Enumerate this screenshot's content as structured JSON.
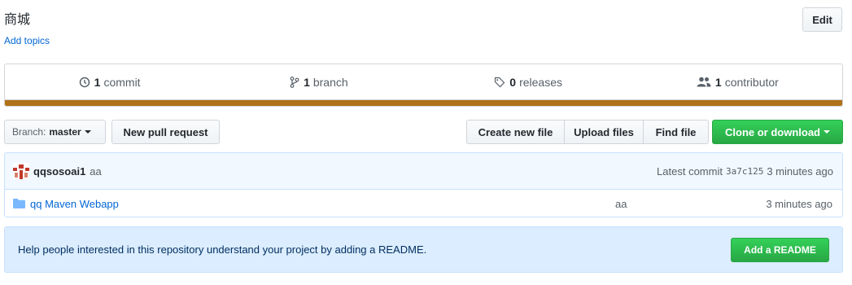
{
  "repo": {
    "description": "商城",
    "add_topics": "Add topics",
    "edit_label": "Edit"
  },
  "summary": {
    "commits": {
      "count": "1",
      "label": "commit",
      "icon": "history-icon"
    },
    "branches": {
      "count": "1",
      "label": "branch",
      "icon": "git-branch-icon"
    },
    "releases": {
      "count": "0",
      "label": "releases",
      "icon": "tag-icon"
    },
    "contributors": {
      "count": "1",
      "label": "contributor",
      "icon": "people-icon"
    },
    "language_color": "#b07219"
  },
  "toolbar": {
    "branch_label": "Branch:",
    "branch_value": "master",
    "new_pull_request": "New pull request",
    "create_new_file": "Create new file",
    "upload_files": "Upload files",
    "find_file": "Find file",
    "clone_or_download": "Clone or download"
  },
  "commit": {
    "author": "qqsosoai1",
    "message": "aa",
    "latest_label": "Latest commit",
    "sha": "3a7c125",
    "age": "3 minutes ago"
  },
  "files": [
    {
      "name": "qq Maven Webapp",
      "type": "folder",
      "message": "aa",
      "age": "3 minutes ago"
    }
  ],
  "readme": {
    "prompt": "Help people interested in this repository understand your project by adding a README.",
    "button": "Add a README"
  },
  "colors": {
    "link": "#0366d6",
    "primary_green": "#28a745",
    "info_bg": "#dbedff"
  }
}
